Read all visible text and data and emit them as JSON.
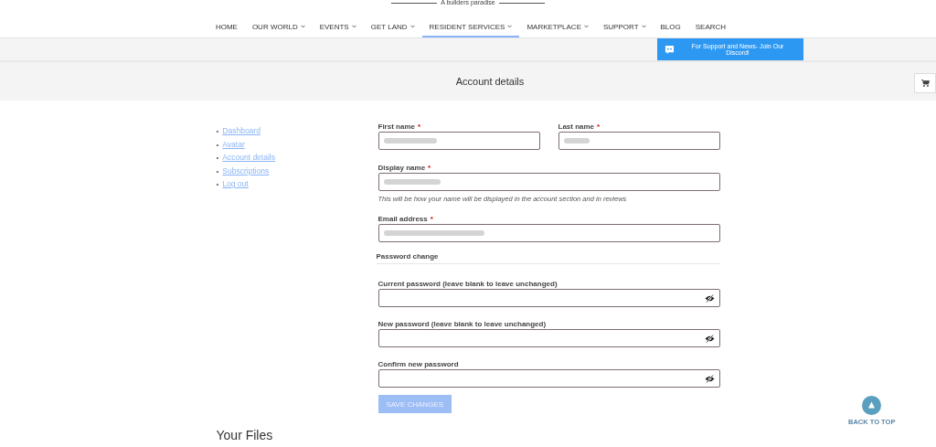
{
  "header": {
    "tagline": "A builders paradise"
  },
  "nav": [
    {
      "label": "HOME",
      "dropdown": false,
      "selected": false
    },
    {
      "label": "OUR WORLD",
      "dropdown": true,
      "selected": false
    },
    {
      "label": "EVENTS",
      "dropdown": true,
      "selected": false
    },
    {
      "label": "GET LAND",
      "dropdown": true,
      "selected": false
    },
    {
      "label": "RESIDENT SERVICES",
      "dropdown": true,
      "selected": true
    },
    {
      "label": "MARKETPLACE",
      "dropdown": true,
      "selected": false
    },
    {
      "label": "SUPPORT",
      "dropdown": true,
      "selected": false
    },
    {
      "label": "BLOG",
      "dropdown": false,
      "selected": false
    },
    {
      "label": "SEARCH",
      "dropdown": false,
      "selected": false
    }
  ],
  "discord_button": {
    "label": "For Support and News- Join Our Discord!"
  },
  "page_title": "Account details",
  "sidebar": {
    "items": [
      {
        "marker": "•",
        "label": "Dashboard",
        "selected": false
      },
      {
        "marker": "•",
        "label": "Avatar",
        "selected": false
      },
      {
        "marker": "•",
        "label": "Account details",
        "selected": false
      },
      {
        "marker": "•",
        "label": "Subscriptions",
        "selected": false
      },
      {
        "marker": "•",
        "label": "Log out",
        "selected": false
      }
    ]
  },
  "form": {
    "name_row": [
      {
        "label": "First name",
        "required_mark": "*"
      },
      {
        "label": "Last name",
        "required_mark": "*"
      }
    ],
    "display_name": {
      "label": "Display name",
      "required_mark": "*",
      "hint": "This will be how your name will be displayed in the account section and in reviews"
    },
    "email": {
      "label": "Email address",
      "required_mark": "*"
    },
    "password_section": {
      "title": "Password change",
      "fields": [
        {
          "label": "Current password (leave blank to leave unchanged)"
        },
        {
          "label": "New password (leave blank to leave unchanged)"
        },
        {
          "label": "Confirm new password"
        }
      ]
    },
    "save_button": {
      "label": "SAVE CHANGES",
      "disabled": true
    }
  },
  "your_files": {
    "title": "Your Files"
  },
  "back_to_top": {
    "label": "BACK TO TOP"
  }
}
